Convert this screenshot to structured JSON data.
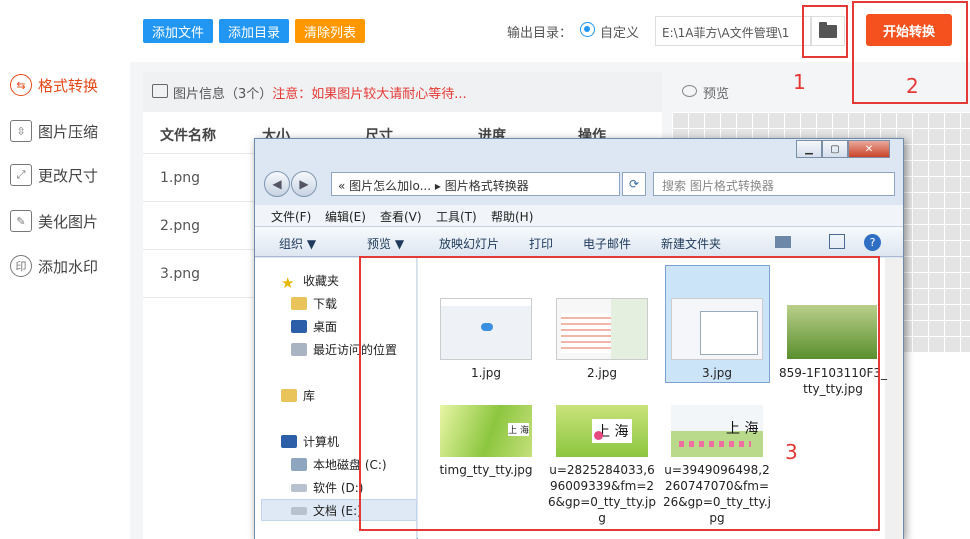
{
  "sidebar": {
    "items": [
      {
        "label": "格式转换",
        "icon": "convert-icon"
      },
      {
        "label": "图片压缩",
        "icon": "compress-icon"
      },
      {
        "label": "更改尺寸",
        "icon": "resize-icon"
      },
      {
        "label": "美化图片",
        "icon": "beautify-icon"
      },
      {
        "label": "添加水印",
        "icon": "watermark-icon"
      }
    ]
  },
  "toolbar": {
    "add_file": "添加文件",
    "add_dir": "添加目录",
    "clear_list": "清除列表",
    "output_label": "输出目录：",
    "custom_label": "自定义",
    "path_value": "E:\\1A菲方\\A文件管理\\1",
    "start_label": "开始转换"
  },
  "annotations": {
    "n1": "1",
    "n2": "2",
    "n3": "3",
    "color": "#e53935"
  },
  "panel": {
    "title": "图片信息（3个）",
    "warning": "注意：如果图片较大请耐心等待...",
    "columns": [
      "文件名称",
      "大小",
      "尺寸",
      "进度",
      "操作"
    ],
    "rows": [
      "1.png",
      "2.png",
      "3.png"
    ]
  },
  "preview": {
    "title": "预览"
  },
  "dialog": {
    "address": "« 图片怎么加lo... ▸ 图片格式转换器",
    "search_placeholder": "搜索 图片格式转换器",
    "menu": [
      "文件(F)",
      "编辑(E)",
      "查看(V)",
      "工具(T)",
      "帮助(H)"
    ],
    "tools": [
      "组织 ▼",
      "预览 ▼",
      "放映幻灯片",
      "打印",
      "电子邮件",
      "新建文件夹"
    ],
    "nav": {
      "favorites": "收藏夹",
      "downloads": "下载",
      "desktop": "桌面",
      "recent": "最近访问的位置",
      "library": "库",
      "computer": "计算机",
      "drive_c": "本地磁盘 (C:)",
      "drive_d": "软件 (D:)",
      "drive_e": "文档 (E:)"
    },
    "files": [
      {
        "name": "1.jpg"
      },
      {
        "name": "2.jpg"
      },
      {
        "name": "3.jpg"
      },
      {
        "name": "859-1F103110F3_tty_tty.jpg"
      },
      {
        "name": "timg_tty_tty.jpg"
      },
      {
        "name": "u=2825284033,696009339&fm=26&gp=0_tty_tty.jpg"
      },
      {
        "name": "u=3949096498,2260747070&fm=26&gp=0_tty_tty.jpg"
      }
    ],
    "thumb_text": "上 海"
  }
}
